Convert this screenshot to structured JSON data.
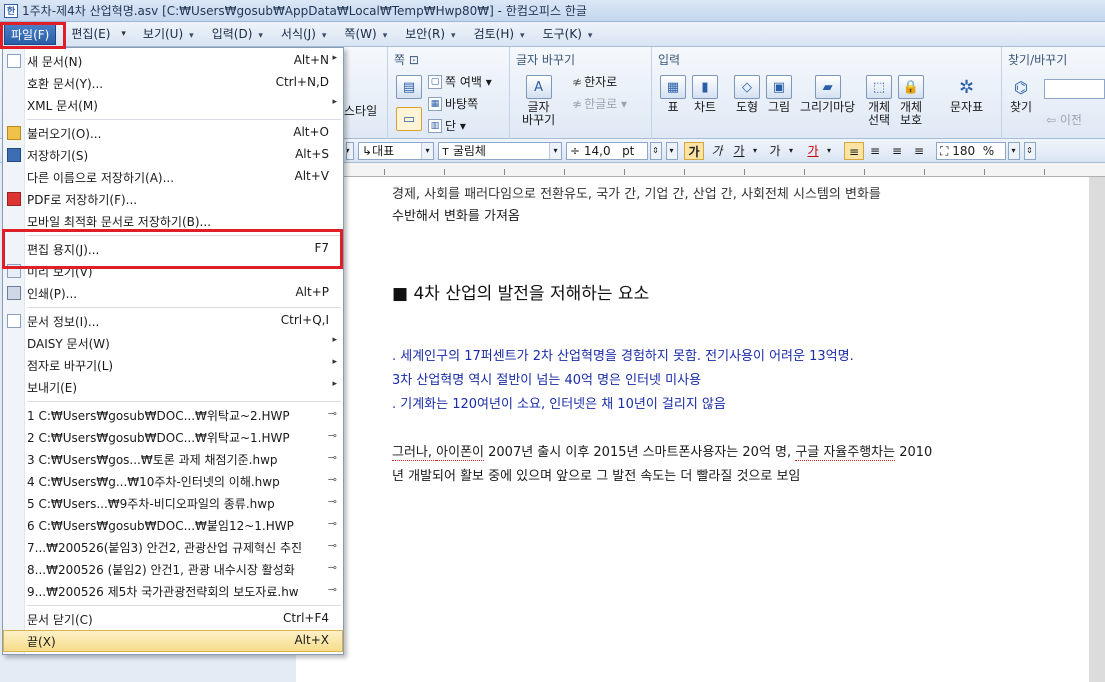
{
  "window": {
    "title": "1주차-제4차 산업혁명.asv [C:₩Users₩gosub₩AppData₩Local₩Temp₩Hwp80₩] - 한컴오피스 한글"
  },
  "menubar": {
    "items": [
      "파일(F)",
      "편집(E)",
      "보기(U)",
      "입력(D)",
      "서식(J)",
      "쪽(W)",
      "보안(R)",
      "검토(H)",
      "도구(K)"
    ]
  },
  "ribbon": {
    "style_label": "스타일",
    "page_group": {
      "title": "쪽",
      "margin": "쪽 여백",
      "background": "바탕쪽",
      "column": "단"
    },
    "change_group": {
      "title": "글자 바꾸기",
      "hanja": "한자로",
      "hangul": "한글로",
      "change_label": "글자",
      "change_label2": "바꾸기"
    },
    "input_group": {
      "title": "입력",
      "table": "표",
      "chart": "차트",
      "shape": "도형",
      "picture": "그림",
      "drawing_magic": "그리기마당",
      "obj_select": "개체",
      "obj_select2": "선택",
      "obj_protect": "개체",
      "obj_protect2": "보호",
      "char_table": "문자표"
    },
    "find_group": {
      "title": "찾기/바꾸기",
      "find": "찾기",
      "prev": "이전"
    }
  },
  "formatbar": {
    "style": "대표",
    "font": "굴림체",
    "size": "14,0",
    "unit": "pt",
    "bold": "가",
    "italic": "가",
    "underline": "가",
    "strike": "가",
    "color": "가",
    "zoom": "180",
    "zoom_unit": "%"
  },
  "file_menu": {
    "items": [
      {
        "label": "새 문서(N)",
        "shortcut": "Alt+N",
        "submenu": true
      },
      {
        "label": "호환 문서(Y)...",
        "shortcut": "Ctrl+N,D"
      },
      {
        "label": "XML 문서(M)",
        "submenu": true
      },
      {
        "label": "불러오기(O)...",
        "shortcut": "Alt+O"
      },
      {
        "label": "저장하기(S)",
        "shortcut": "Alt+S"
      },
      {
        "label": "다른 이름으로 저장하기(A)...",
        "shortcut": "Alt+V"
      },
      {
        "label": "PDF로 저장하기(F)..."
      },
      {
        "label": "모바일 최적화 문서로 저장하기(B)..."
      },
      {
        "label": "편집 용지(J)...",
        "shortcut": "F7"
      },
      {
        "label": "미리 보기(V)"
      },
      {
        "label": "인쇄(P)...",
        "shortcut": "Alt+P"
      },
      {
        "label": "문서 정보(I)...",
        "shortcut": "Ctrl+Q,I"
      },
      {
        "label": "DAISY 문서(W)",
        "submenu": true
      },
      {
        "label": "점자로 바꾸기(L)",
        "submenu": true
      },
      {
        "label": "보내기(E)",
        "submenu": true
      },
      {
        "label": "1 C:₩Users₩gosub₩DOC...₩위탁교~2.HWP"
      },
      {
        "label": "2 C:₩Users₩gosub₩DOC...₩위탁교~1.HWP"
      },
      {
        "label": "3 C:₩Users₩gos...₩토론 과제 채점기준.hwp"
      },
      {
        "label": "4 C:₩Users₩g...₩10주차-인터넷의 이해.hwp"
      },
      {
        "label": "5 C:₩Users...₩9주차-비디오파일의 종류.hwp"
      },
      {
        "label": "6 C:₩Users₩gosub₩DOC...₩붙임12~1.HWP"
      },
      {
        "label": "7...₩200526(붙임3) 안건2, 관광산업 규제혁신 추진"
      },
      {
        "label": "8...₩200526 (붙임2) 안건1, 관광 내수시장 활성화"
      },
      {
        "label": "9...₩200526 제5차 국가관광전략회의 보도자료.hw"
      },
      {
        "label": "문서 닫기(C)",
        "shortcut": "Ctrl+F4"
      },
      {
        "label": "끝(X)",
        "shortcut": "Alt+X"
      }
    ]
  },
  "document": {
    "line_cut": "경제,  사회를 패러다임으로 전환유도, 국가 간, 기업 간, 산업 간, 사회전체 시스템의 변화를",
    "line1": "수반해서 변화를 가져옴",
    "heading": "■ 4차 산업의 발전을 저해하는 요소",
    "blue1": ". 세계인구의 17퍼센트가 2차 산업혁명을 경험하지 못함. 전기사용이 어려운 13억명.",
    "blue2": "  3차 산업혁명 역시 절반이 넘는 40억 명은 인터넷 미사용",
    "blue3": ". 기계화는 120여년이 소요, 인터넷은 채 10년이 걸리지 않음",
    "para1a": "그러나, ",
    "para1b": "아이폰이",
    "para1c": " 2007년 출시 이후 2015년 스마트폰사용자는 20억 명, ",
    "para1d": "구글 자율주행차는",
    "para1e": " 2010",
    "para2": "년 개발되어 활보 중에 있으며 앞으로 그 발전 속도는 더 빨라질 것으로 보임"
  },
  "colors": {
    "highlight_border": "#e01e28",
    "doc_blue": "#1a2ca8",
    "menu_hover": "#f6dc8a"
  }
}
